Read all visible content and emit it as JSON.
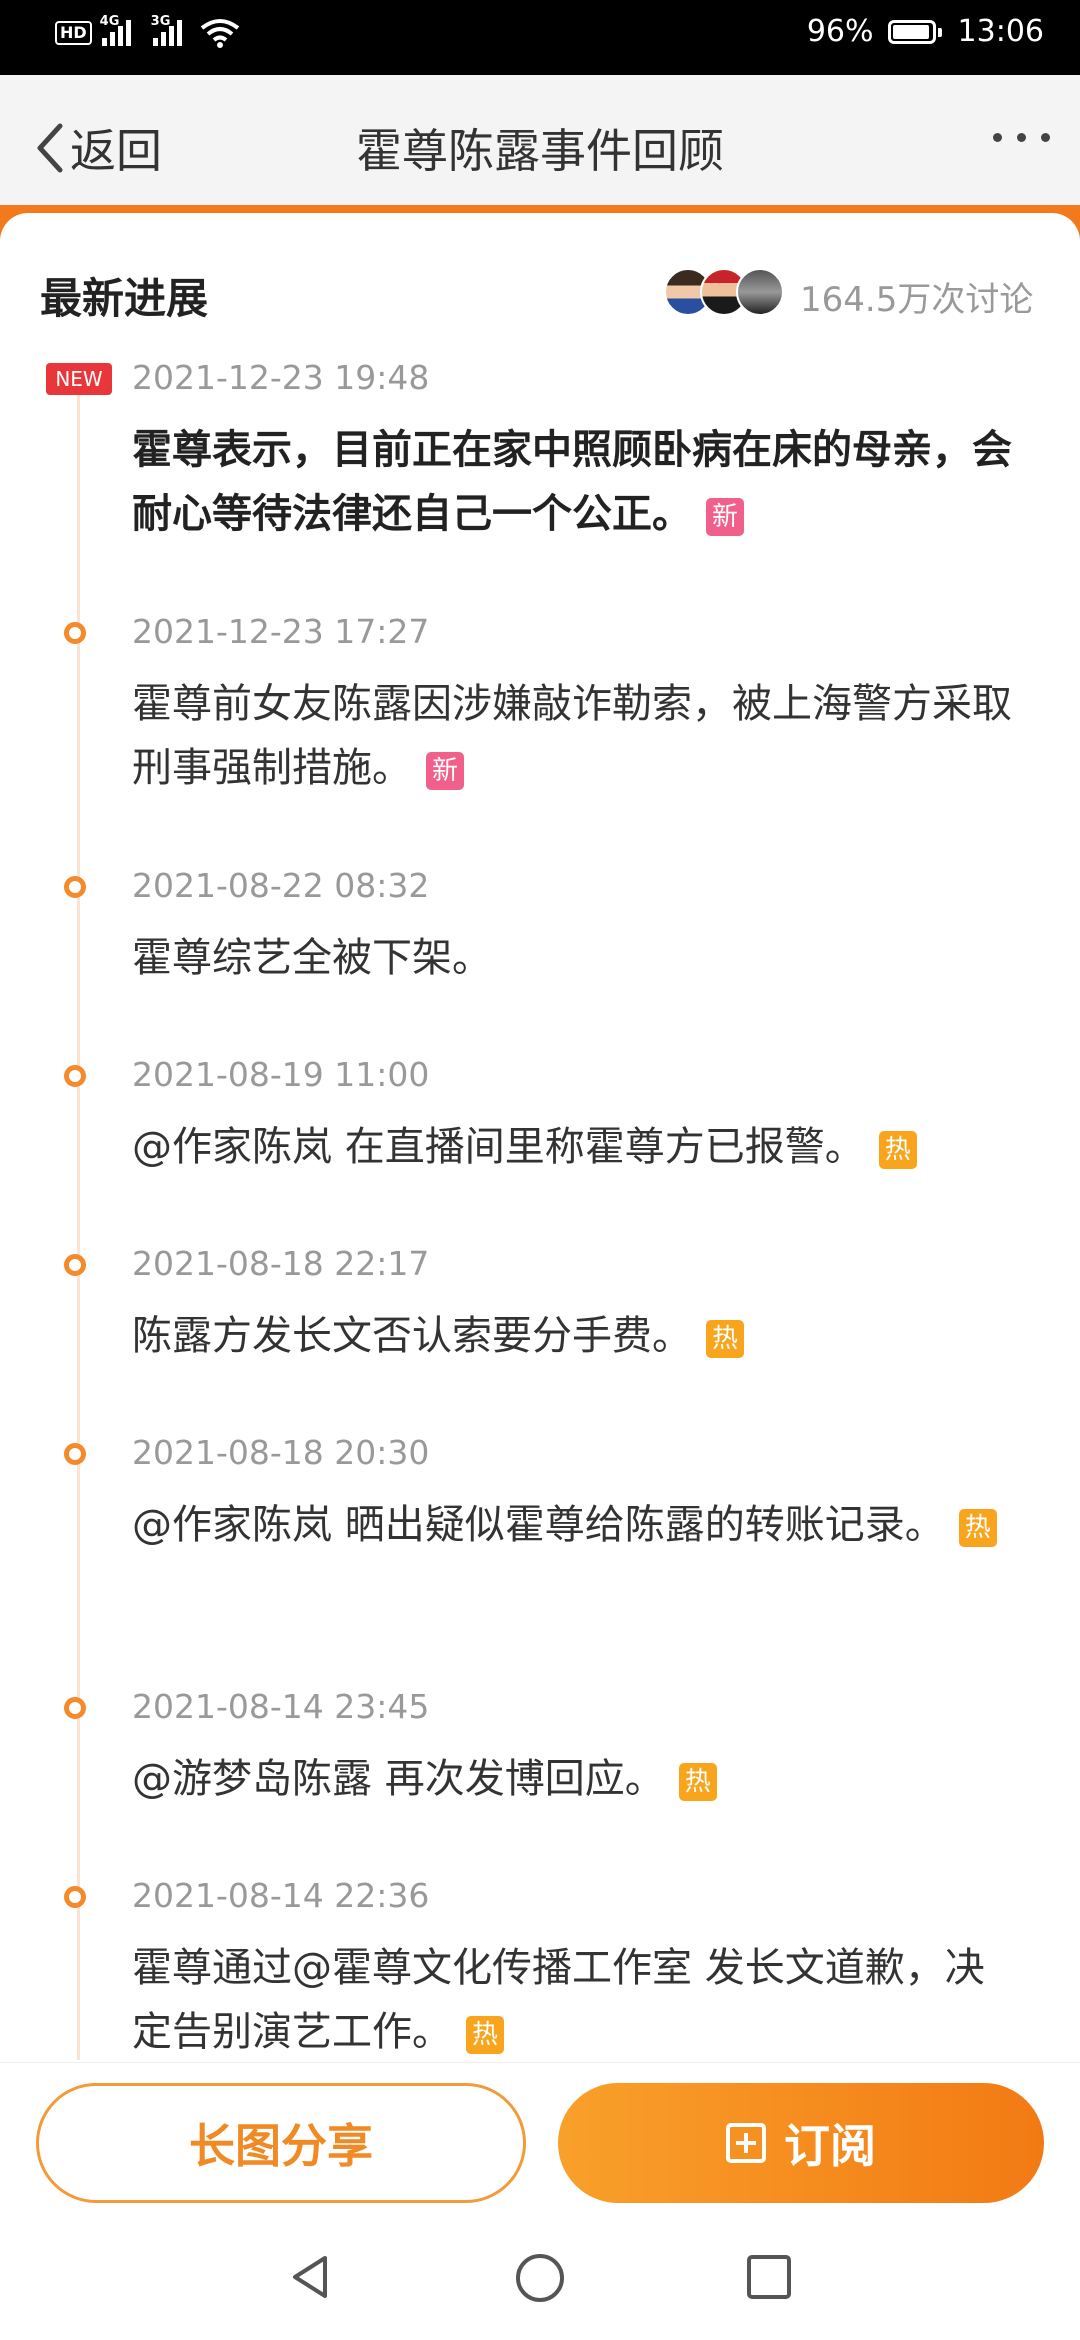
{
  "status_bar": {
    "hd_label": "HD",
    "net1": "4G",
    "net2": "3G",
    "battery_percent": "96%",
    "battery_level": 0.96,
    "time": "13:06"
  },
  "nav": {
    "back_label": "返回",
    "title": "霍尊陈露事件回顾"
  },
  "header": {
    "section_title": "最新进展",
    "discussion_count": "164.5万次讨论"
  },
  "events": [
    {
      "time": "2021-12-23 19:48",
      "text": "霍尊表示，目前正在家中照顾卧病在床的母亲，会耐心等待法律还自己一个公正。",
      "tag": "新",
      "badge": "NEW"
    },
    {
      "time": "2021-12-23 17:27",
      "text": "霍尊前女友陈露因涉嫌敲诈勒索，被上海警方采取刑事强制措施。",
      "tag": "新"
    },
    {
      "time": "2021-08-22 08:32",
      "text": "霍尊综艺全被下架。"
    },
    {
      "time": "2021-08-19 11:00",
      "text": "@作家陈岚 在直播间里称霍尊方已报警。",
      "tag": "热"
    },
    {
      "time": "2021-08-18 22:17",
      "text": "陈露方发长文否认索要分手费。",
      "tag": "热"
    },
    {
      "time": "2021-08-18 20:30",
      "text": "@作家陈岚 晒出疑似霍尊给陈露的转账记录。",
      "tag": "热"
    },
    {
      "time": "2021-08-14 23:45",
      "text": "@游梦岛陈露 再次发博回应。",
      "tag": "热"
    },
    {
      "time": "2021-08-14 22:36",
      "text": "霍尊通过@霍尊文化传播工作室 发长文道歉，决定告别演艺工作。",
      "tag": "热"
    }
  ],
  "bottom": {
    "share_label": "长图分享",
    "subscribe_label": "订阅"
  },
  "colors": {
    "accent": "#f27a1d",
    "new_tag": "#f0608a",
    "hot_tag": "#f9a41d",
    "new_badge": "#e8363b"
  }
}
